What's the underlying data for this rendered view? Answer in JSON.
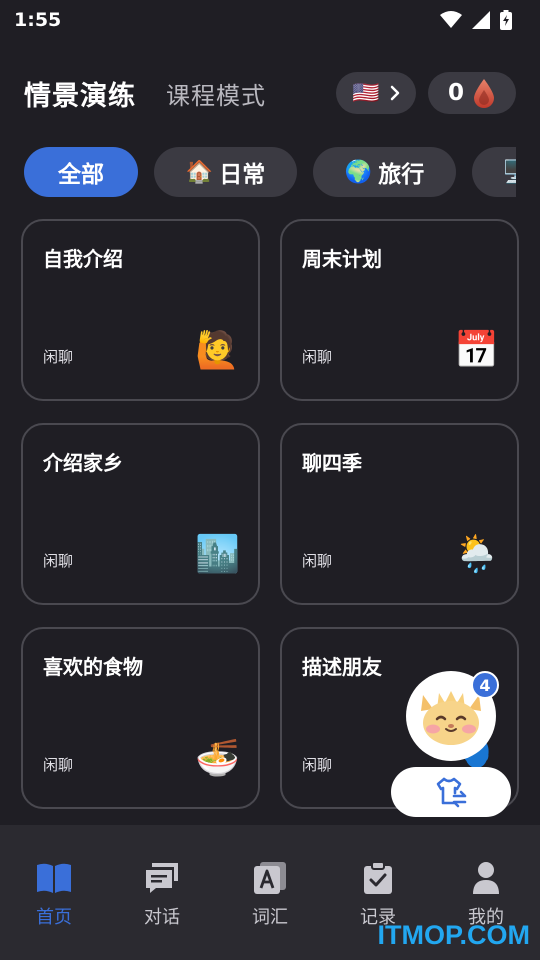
{
  "status_bar": {
    "time": "1:55"
  },
  "header": {
    "title": "情景演练",
    "subtitle": "课程模式",
    "language_flag": "🇺🇸",
    "points": "0",
    "points_icon": "drop-icon"
  },
  "filters": [
    {
      "emoji": "",
      "label": "全部",
      "active": true
    },
    {
      "emoji": "🏠",
      "label": "日常",
      "active": false
    },
    {
      "emoji": "🌍",
      "label": "旅行",
      "active": false
    },
    {
      "emoji": "🖥️",
      "label": "",
      "active": false
    }
  ],
  "cards": [
    {
      "title": "自我介绍",
      "tag": "闲聊",
      "emoji": "🙋"
    },
    {
      "title": "周末计划",
      "tag": "闲聊",
      "emoji": "📅"
    },
    {
      "title": "介绍家乡",
      "tag": "闲聊",
      "emoji": "🏙️"
    },
    {
      "title": "聊四季",
      "tag": "闲聊",
      "emoji": "🌦️"
    },
    {
      "title": "喜欢的食物",
      "tag": "闲聊",
      "emoji": "🍜"
    },
    {
      "title": "描述朋友",
      "tag": "闲聊",
      "emoji": "👤"
    }
  ],
  "floating": {
    "badge_count": "4"
  },
  "tabbar": [
    {
      "label": "首页",
      "icon": "book-icon",
      "active": true
    },
    {
      "label": "对话",
      "icon": "chat-icon",
      "active": false
    },
    {
      "label": "词汇",
      "icon": "vocabulary-icon",
      "active": false
    },
    {
      "label": "记录",
      "icon": "clipboard-icon",
      "active": false
    },
    {
      "label": "我的",
      "icon": "person-icon",
      "active": false
    }
  ],
  "watermark": "ITMOP.COM",
  "colors": {
    "background": "#1f1e24",
    "accent": "#3a6fd9",
    "chip": "#3b3a42",
    "tabbar": "#2b2a30"
  }
}
